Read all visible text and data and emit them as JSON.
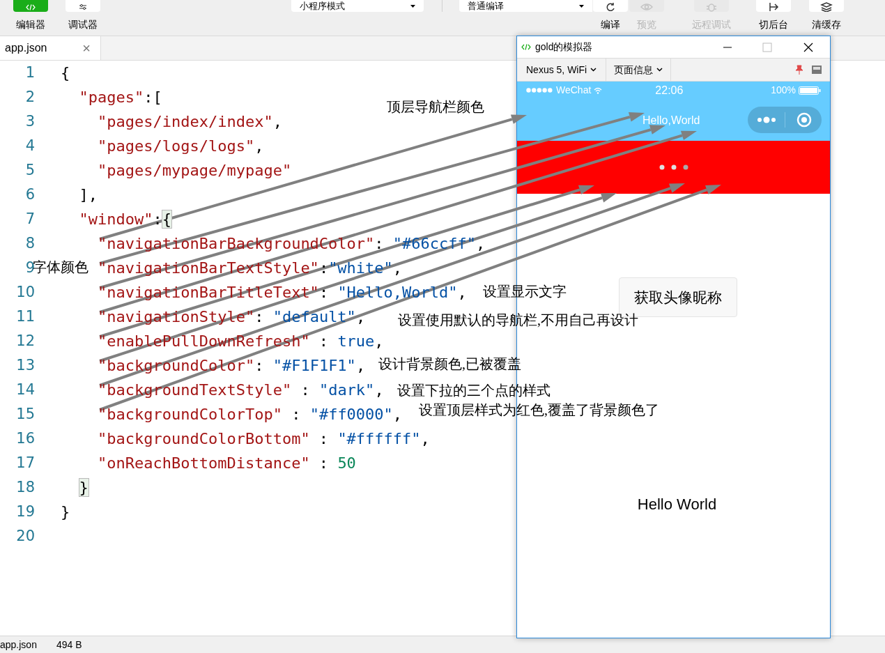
{
  "toolbar": {
    "modes": [
      {
        "label": "编辑器",
        "selected": true
      },
      {
        "label": "调试器",
        "selected": false
      }
    ],
    "mode_select": {
      "value": "小程序模式"
    },
    "compile_select": {
      "value": "普通编译"
    },
    "actions": [
      {
        "kind": "compile",
        "label": "编译",
        "disabled": false
      },
      {
        "kind": "preview",
        "label": "预览",
        "disabled": true
      },
      {
        "kind": "remote",
        "label": "远程调试",
        "disabled": true
      },
      {
        "kind": "background",
        "label": "切后台",
        "disabled": false
      },
      {
        "kind": "cache",
        "label": "清缓存",
        "disabled": false
      }
    ]
  },
  "editor": {
    "tabs": [
      {
        "label": "app.json",
        "selected": true,
        "close": "×"
      }
    ],
    "lines": [
      {
        "number": "1",
        "tokens": [
          {
            "kind": "punct",
            "text": "{"
          }
        ]
      },
      {
        "number": "2",
        "tokens": [
          {
            "kind": "key",
            "text": "  \"pages\""
          },
          {
            "kind": "punct",
            "text": ":["
          }
        ]
      },
      {
        "number": "3",
        "tokens": [
          {
            "kind": "key",
            "text": "    \"pages/index/index\""
          },
          {
            "kind": "punct",
            "text": ","
          }
        ]
      },
      {
        "number": "4",
        "tokens": [
          {
            "kind": "key",
            "text": "    \"pages/logs/logs\""
          },
          {
            "kind": "punct",
            "text": ","
          }
        ]
      },
      {
        "number": "5",
        "tokens": [
          {
            "kind": "key",
            "text": "    \"pages/mypage/mypage\""
          }
        ]
      },
      {
        "number": "6",
        "tokens": [
          {
            "kind": "punct",
            "text": "  ],"
          }
        ]
      },
      {
        "number": "7",
        "tokens": [
          {
            "kind": "key",
            "text": "  \"window\""
          },
          {
            "kind": "punct",
            "text": ":"
          },
          {
            "kind": "match",
            "text": "{"
          }
        ]
      },
      {
        "number": "8",
        "tokens": [
          {
            "kind": "key",
            "text": "    \"navigationBarBackgroundColor\""
          },
          {
            "kind": "punct",
            "text": ": "
          },
          {
            "kind": "string",
            "text": "\"#66ccff\""
          },
          {
            "kind": "punct",
            "text": ","
          }
        ]
      },
      {
        "number": "9",
        "tokens": [
          {
            "kind": "key",
            "text": "    \"navigationBarTextStyle\""
          },
          {
            "kind": "punct",
            "text": ":"
          },
          {
            "kind": "string",
            "text": "\"white\""
          },
          {
            "kind": "punct",
            "text": ","
          }
        ]
      },
      {
        "number": "10",
        "tokens": [
          {
            "kind": "key",
            "text": "    \"navigationBarTitleText\""
          },
          {
            "kind": "punct",
            "text": ": "
          },
          {
            "kind": "string",
            "text": "\"Hello,World\""
          },
          {
            "kind": "punct",
            "text": ","
          }
        ]
      },
      {
        "number": "11",
        "tokens": [
          {
            "kind": "key",
            "text": "    \"navigationStyle\""
          },
          {
            "kind": "punct",
            "text": ": "
          },
          {
            "kind": "string",
            "text": "\"default\""
          },
          {
            "kind": "punct",
            "text": ","
          }
        ]
      },
      {
        "number": "12",
        "tokens": [
          {
            "kind": "key",
            "text": "    \"enablePullDownRefresh\""
          },
          {
            "kind": "punct",
            "text": " : "
          },
          {
            "kind": "string",
            "text": "true"
          },
          {
            "kind": "punct",
            "text": ","
          }
        ]
      },
      {
        "number": "13",
        "tokens": [
          {
            "kind": "key",
            "text": "    \"backgroundColor\""
          },
          {
            "kind": "punct",
            "text": ": "
          },
          {
            "kind": "string",
            "text": "\"#F1F1F1\""
          },
          {
            "kind": "punct",
            "text": ","
          }
        ]
      },
      {
        "number": "14",
        "tokens": [
          {
            "kind": "key",
            "text": "    \"backgroundTextStyle\""
          },
          {
            "kind": "punct",
            "text": " : "
          },
          {
            "kind": "string",
            "text": "\"dark\""
          },
          {
            "kind": "punct",
            "text": ","
          }
        ]
      },
      {
        "number": "15",
        "tokens": [
          {
            "kind": "key",
            "text": "    \"backgroundColorTop\""
          },
          {
            "kind": "punct",
            "text": " : "
          },
          {
            "kind": "string",
            "text": "\"#ff0000\""
          },
          {
            "kind": "punct",
            "text": ","
          }
        ]
      },
      {
        "number": "16",
        "tokens": [
          {
            "kind": "key",
            "text": "    \"backgroundColorBottom\""
          },
          {
            "kind": "punct",
            "text": " : "
          },
          {
            "kind": "string",
            "text": "\"#ffffff\""
          },
          {
            "kind": "punct",
            "text": ","
          }
        ]
      },
      {
        "number": "17",
        "tokens": [
          {
            "kind": "key",
            "text": "    \"onReachBottomDistance\""
          },
          {
            "kind": "punct",
            "text": " : "
          },
          {
            "kind": "number",
            "text": "50"
          }
        ]
      },
      {
        "number": "18",
        "tokens": [
          {
            "kind": "match",
            "text": "  }"
          }
        ]
      },
      {
        "number": "19",
        "tokens": [
          {
            "kind": "punct",
            "text": "}"
          }
        ]
      },
      {
        "number": "20"
      }
    ],
    "annotations": [
      "顶层导航栏颜色",
      "字体颜色",
      "设置显示文字",
      "设置使用默认的导航栏,不用自己再设计",
      "设计背景颜色,已被覆盖",
      "设置下拉的三个点的样式",
      "设置顶层样式为红色,覆盖了背景颜色了"
    ]
  },
  "simulator": {
    "title": "gold的模拟器",
    "device": "Nexus 5, WiFi",
    "page_info": "页面信息",
    "phone": {
      "carrier": "WeChat",
      "time": "22:06",
      "battery": "100%",
      "nav_title": "Hello,World",
      "button": "获取头像昵称",
      "text": "Hello World"
    }
  },
  "status_bar": {
    "file": "app.json",
    "size": "494 B"
  }
}
